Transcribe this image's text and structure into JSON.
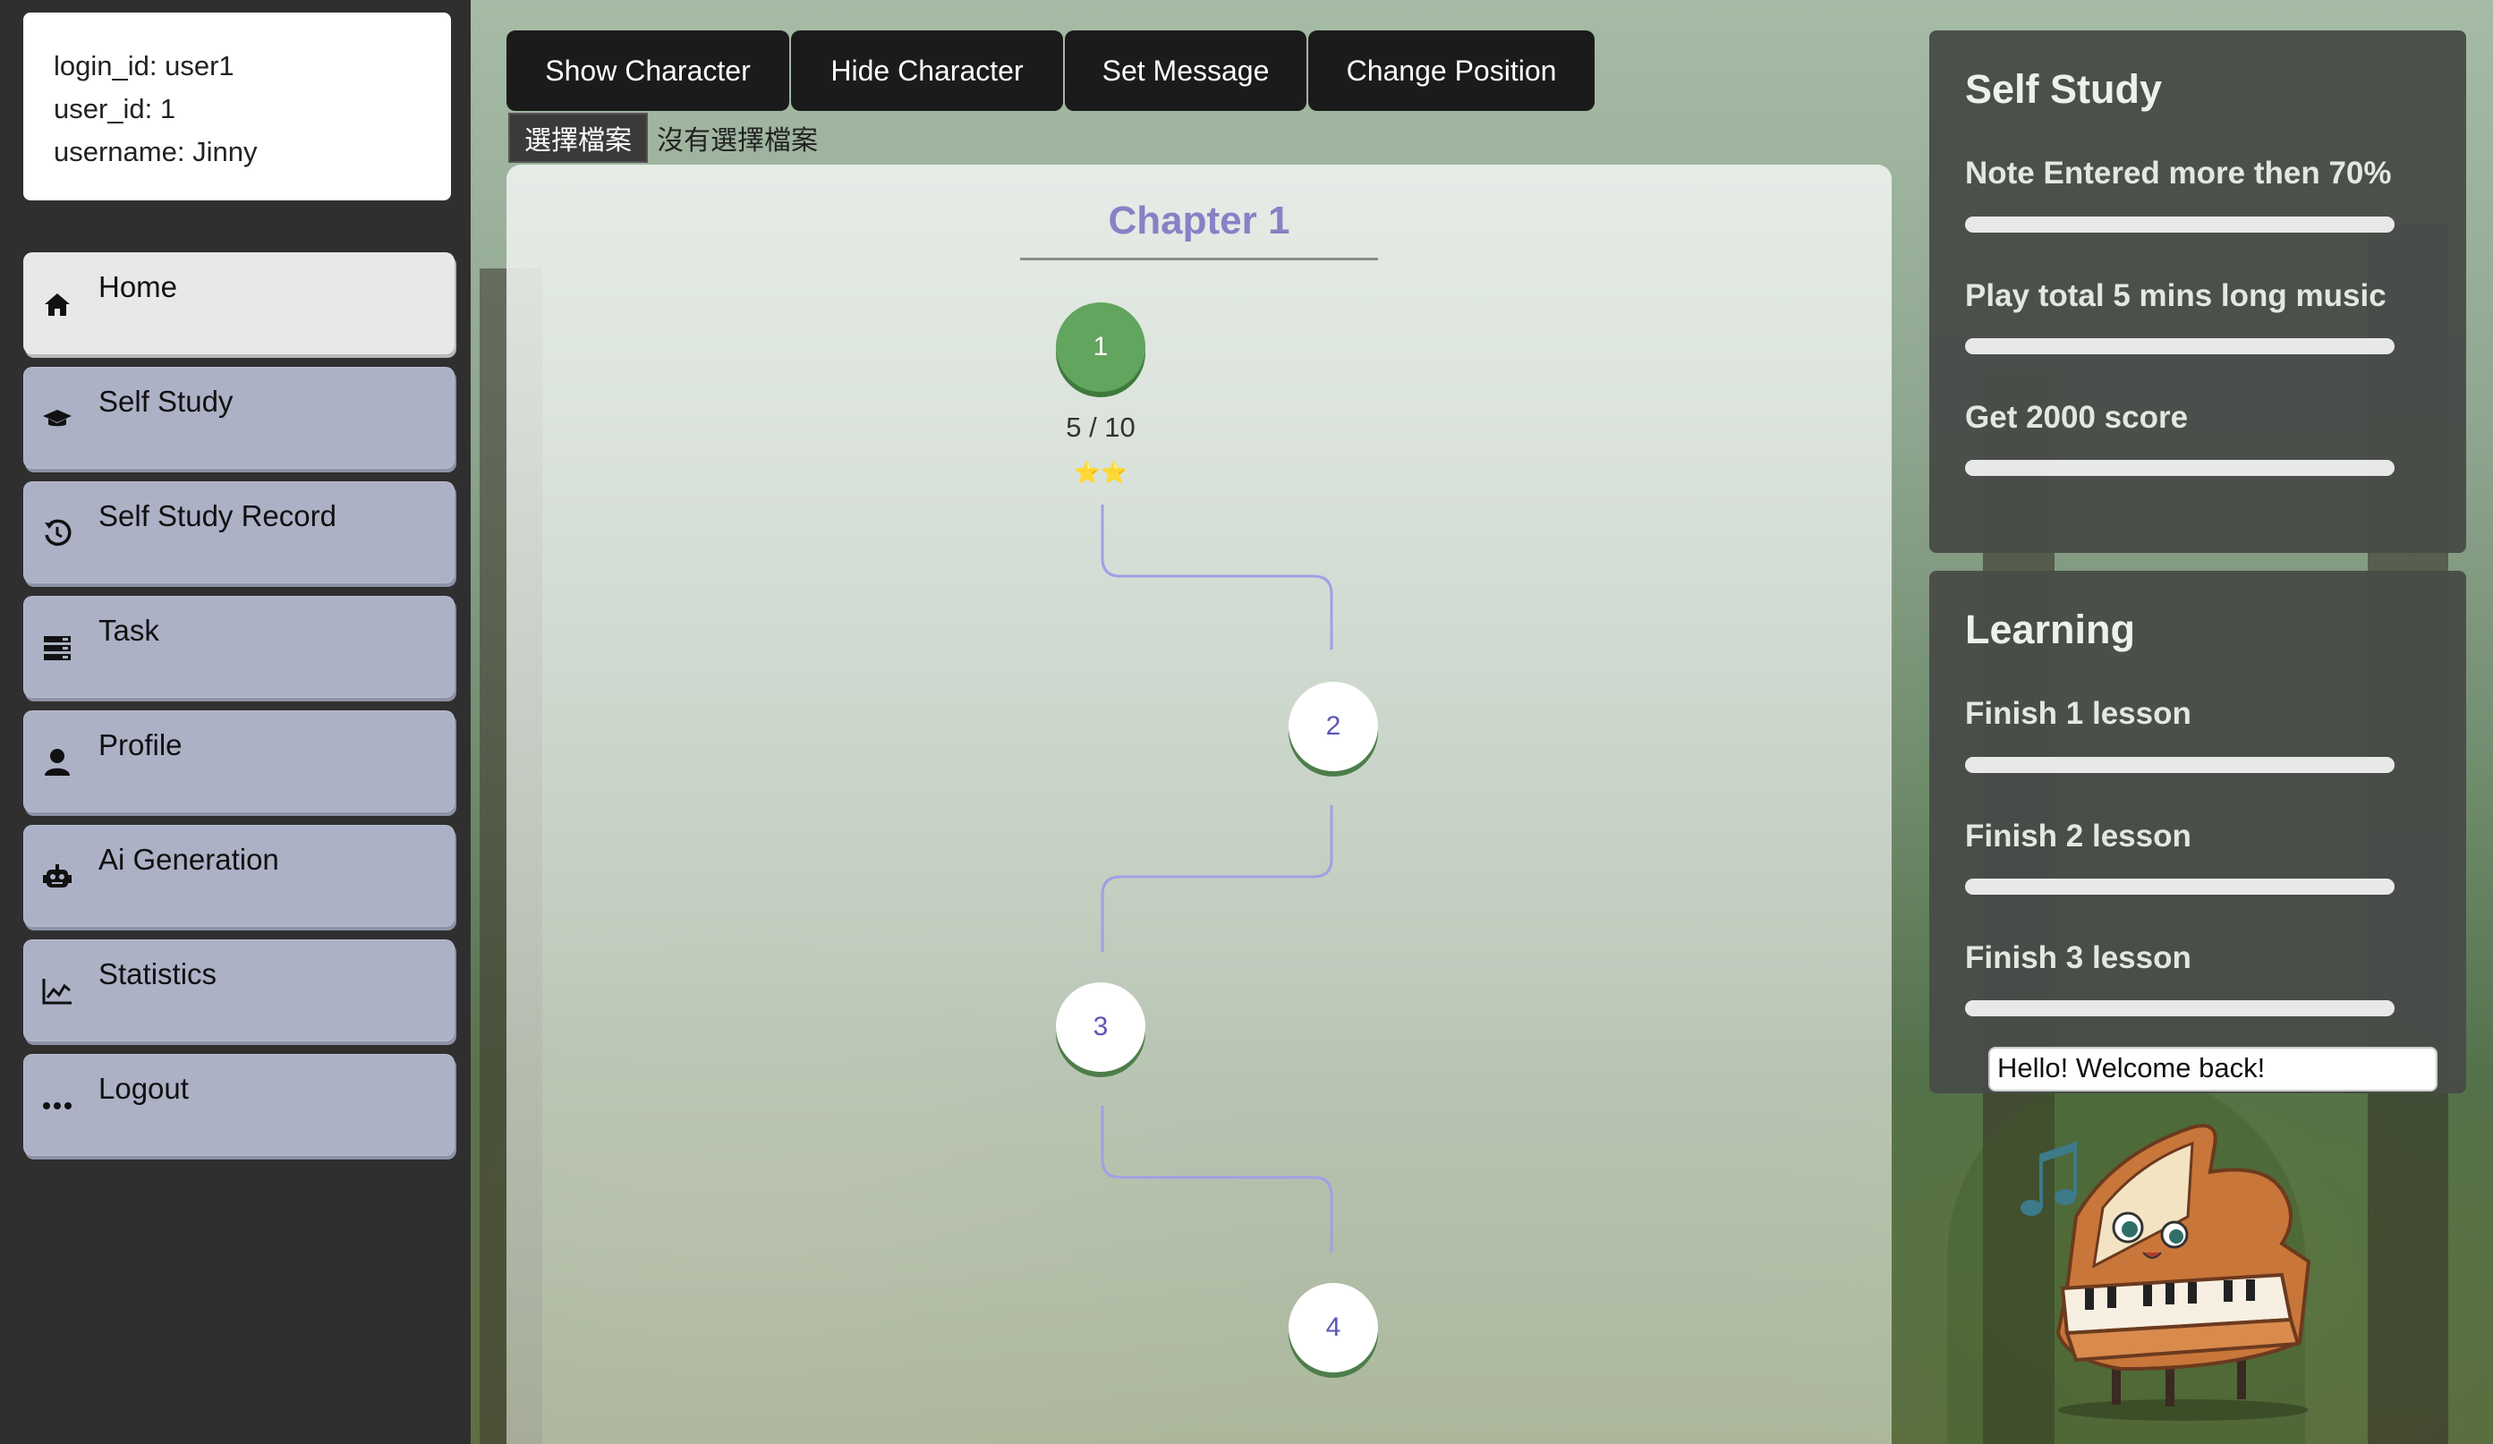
{
  "user": {
    "login_line": "login_id: user1",
    "id_line": "user_id: 1",
    "name_line": "username: Jinny"
  },
  "sidebar": {
    "items": [
      {
        "label": "Home",
        "icon": "home-icon",
        "active": true
      },
      {
        "label": "Self Study",
        "icon": "graduation-cap-icon",
        "active": false
      },
      {
        "label": "Self Study Record",
        "icon": "history-icon",
        "active": false
      },
      {
        "label": "Task",
        "icon": "task-list-icon",
        "active": false
      },
      {
        "label": "Profile",
        "icon": "user-icon",
        "active": false
      },
      {
        "label": "Ai Generation",
        "icon": "robot-icon",
        "active": false
      },
      {
        "label": "Statistics",
        "icon": "chart-line-icon",
        "active": false
      },
      {
        "label": "Logout",
        "icon": "ellipsis-icon",
        "active": false
      }
    ]
  },
  "toolbar": {
    "show_character": "Show Character",
    "hide_character": "Hide Character",
    "set_message": "Set Message",
    "change_position": "Change Position",
    "file_button": "選擇檔案",
    "file_status": "沒有選擇檔案"
  },
  "chapter": {
    "title": "Chapter 1",
    "nodes": [
      {
        "label": "1",
        "state": "done",
        "score": "5 / 10",
        "stars": "⭐⭐"
      },
      {
        "label": "2",
        "state": "open"
      },
      {
        "label": "3",
        "state": "open"
      },
      {
        "label": "4",
        "state": "open"
      }
    ]
  },
  "self_study": {
    "title": "Self Study",
    "goals": [
      {
        "label": "Note Entered more then 70%",
        "progress": 0
      },
      {
        "label": "Play total 5 mins long music",
        "progress": 0
      },
      {
        "label": "Get 2000 score",
        "progress": 0
      }
    ]
  },
  "learning": {
    "title": "Learning",
    "goals": [
      {
        "label": "Finish 1 lesson",
        "progress": 0
      },
      {
        "label": "Finish 2 lesson",
        "progress": 0
      },
      {
        "label": "Finish 3 lesson",
        "progress": 0
      }
    ]
  },
  "character": {
    "message": "Hello! Welcome back!",
    "icon": "piano-mascot-icon"
  },
  "colors": {
    "done_node": "#62a55e",
    "chapter_title": "#8a80c6",
    "path_line": "#a39ee6"
  }
}
